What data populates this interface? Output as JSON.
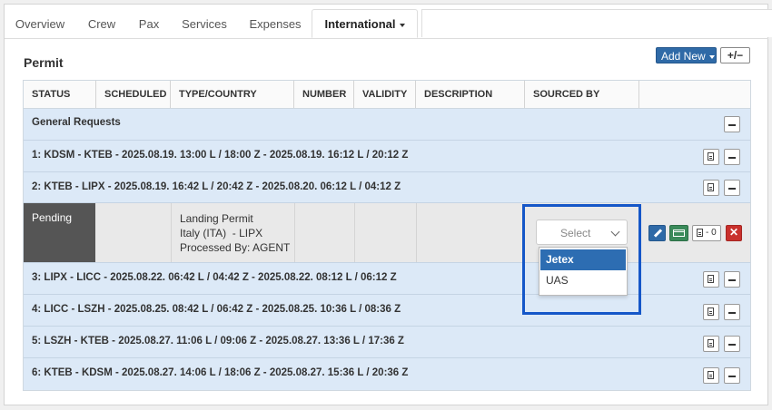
{
  "tabs": [
    {
      "label": "Overview"
    },
    {
      "label": "Crew"
    },
    {
      "label": "Pax"
    },
    {
      "label": "Services"
    },
    {
      "label": "Expenses"
    },
    {
      "label": "International"
    }
  ],
  "section": {
    "title": "Permit"
  },
  "toolbar": {
    "add_new": "Add New",
    "toggle": "+/−"
  },
  "table": {
    "headers": [
      "STATUS",
      "SCHEDULED",
      "TYPE/COUNTRY",
      "NUMBER",
      "VALIDITY",
      "DESCRIPTION",
      "SOURCED BY"
    ],
    "general": "General Requests",
    "legs": [
      "1: KDSM - KTEB - 2025.08.19. 13:00 L / 18:00 Z - 2025.08.19. 16:12 L / 20:12 Z",
      "2: KTEB - LIPX - 2025.08.19. 16:42 L / 20:42 Z - 2025.08.20. 06:12 L / 04:12 Z",
      "3: LIPX - LICC - 2025.08.22. 06:42 L / 04:42 Z - 2025.08.22. 08:12 L / 06:12 Z",
      "4: LICC - LSZH - 2025.08.25. 08:42 L / 06:42 Z - 2025.08.25. 10:36 L / 08:36 Z",
      "5: LSZH - KTEB - 2025.08.27. 11:06 L / 09:06 Z - 2025.08.27. 13:36 L / 17:36 Z",
      "6: KTEB - KDSM - 2025.08.27. 14:06 L / 18:06 Z - 2025.08.27. 15:36 L / 20:36 Z"
    ],
    "permit": {
      "status": "Pending",
      "type": "Landing Permit",
      "country": "Italy (ITA)  - LIPX",
      "processed": "Processed By: AGENT",
      "doc_count": "0",
      "remove": "✕"
    }
  },
  "sourced_by": {
    "placeholder": "Select",
    "options": [
      "Jetex",
      "UAS"
    ],
    "highlighted": "Jetex"
  },
  "colors": {
    "accent": "#2f6aa7",
    "row_bg": "#dce9f7",
    "highlight": "#1557c8",
    "danger": "#c9302c",
    "success": "#3a8a5a"
  }
}
